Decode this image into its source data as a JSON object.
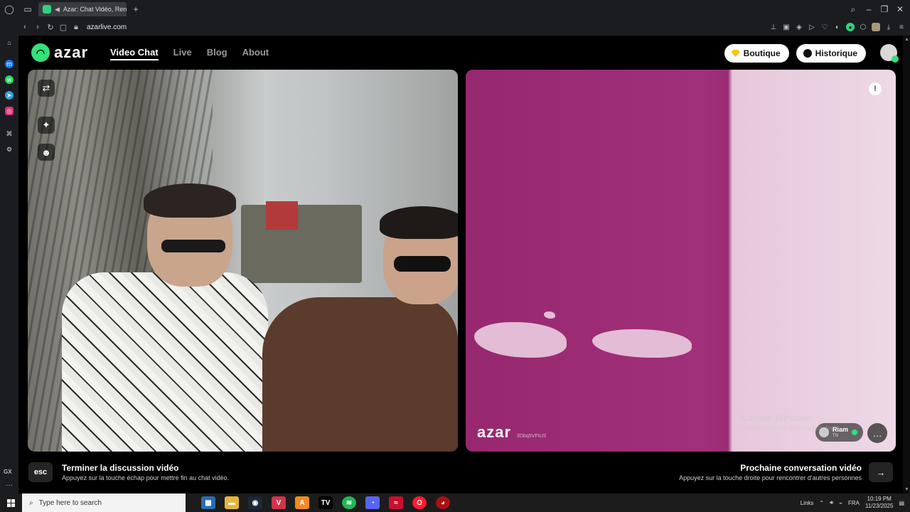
{
  "browser": {
    "tab_title": "Azar: Chat Vidéo, Ren",
    "url": "azarlive.com"
  },
  "site": {
    "logo_text": "azar",
    "nav": [
      "Video Chat",
      "Live",
      "Blog",
      "About"
    ],
    "boutique_label": "Boutique",
    "historique_label": "Historique"
  },
  "remote": {
    "watermark": "azar",
    "id_text": "3Dbq5VFIUS",
    "peer_name": "Riam",
    "peer_country": "TN"
  },
  "controls": {
    "esc_key": "esc",
    "end_title": "Terminer la discussion vidéo",
    "end_sub": "Appuyez sur la touche échap pour mettre fin au chat vidéo.",
    "next_title": "Prochaine conversation vidéo",
    "next_sub": "Appuyez sur la touche droite pour rencontrer d'autres personnes"
  },
  "os": {
    "activate_title": "Activate Windows",
    "activate_sub": "Go to Settings to activate Windows.",
    "search_placeholder": "Type here to search",
    "tray_links": "Links",
    "tray_lang": "FRA",
    "time": "10:19 PM",
    "date": "11/23/2025",
    "gx_label": "GX"
  },
  "colors": {
    "brand_green": "#35e07d",
    "boutique_gem": "#f7c600",
    "remote_wall": "#9a2d74"
  }
}
